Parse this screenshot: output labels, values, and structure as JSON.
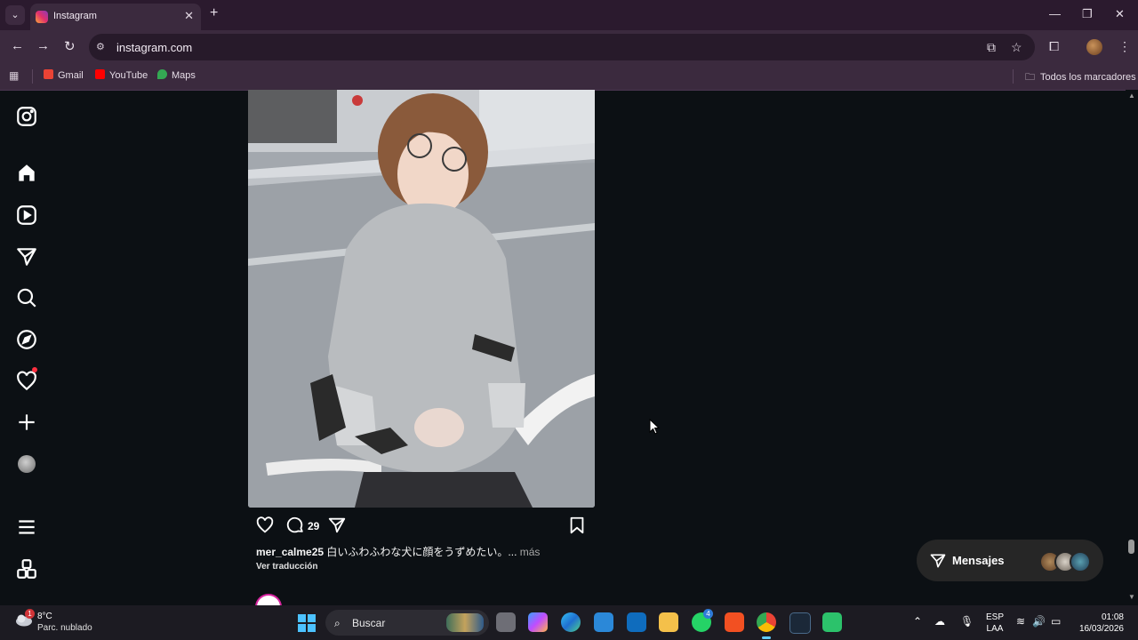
{
  "browser": {
    "tab_title": "Instagram",
    "url": "instagram.com",
    "bookmarks": [
      {
        "label": "Gmail",
        "color": "#ea4335"
      },
      {
        "label": "YouTube",
        "color": "#ff0000"
      },
      {
        "label": "Maps",
        "color": "#34a853"
      }
    ],
    "all_bookmarks_label": "Todos los marcadores"
  },
  "post": {
    "comment_count": "29",
    "username": "mer_calme25",
    "caption": "白いふわふわな犬に顔をうずめたい。...",
    "more_label": "más",
    "translate_label": "Ver traducción"
  },
  "messages": {
    "label": "Mensajes"
  },
  "taskbar": {
    "temperature": "8°C",
    "condition": "Parc. nublado",
    "weather_badge": "1",
    "search_placeholder": "Buscar",
    "whatsapp_badge": "4",
    "lang_top": "ESP",
    "lang_bottom": "LAA",
    "time": "01:08",
    "date": "16/03/2026"
  },
  "colors": {
    "page_bg": "#0c1014",
    "notification": "#ff3040",
    "chrome_frame": "#3b2a3e"
  }
}
